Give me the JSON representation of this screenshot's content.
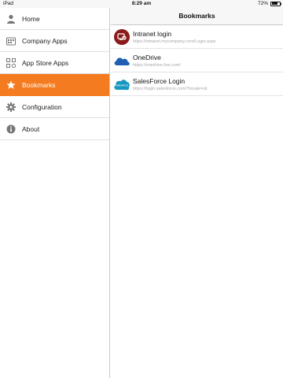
{
  "status_bar": {
    "carrier": "iPad",
    "time": "8:29 am",
    "battery_text": "72%",
    "battery_level": 0.72
  },
  "sidebar": {
    "items": [
      {
        "label": "Home",
        "icon": "person-icon"
      },
      {
        "label": "Company Apps",
        "icon": "company-apps-icon"
      },
      {
        "label": "App Store Apps",
        "icon": "app-store-icon"
      },
      {
        "label": "Bookmarks",
        "icon": "star-icon",
        "active": true
      },
      {
        "label": "Configuration",
        "icon": "gear-icon"
      },
      {
        "label": "About",
        "icon": "info-icon"
      }
    ]
  },
  "header": {
    "title": "Bookmarks"
  },
  "bookmarks": [
    {
      "title": "Intranet login",
      "url": "https://intranet.mycompany.com/Login.aspx",
      "icon": "intranet-icon"
    },
    {
      "title": "OneDrive",
      "url": "https://onedrive.live.com/",
      "icon": "onedrive-cloud-icon"
    },
    {
      "title": "SalesForce Login",
      "url": "https://login.salesforce.com/?locale=uk",
      "icon": "salesforce-icon",
      "icon_text": "salesforce"
    }
  ],
  "colors": {
    "accent": "#f47b20",
    "onedrive": "#1e5fb4",
    "salesforce": "#1798c1",
    "intranet": "#8b1a1a"
  }
}
